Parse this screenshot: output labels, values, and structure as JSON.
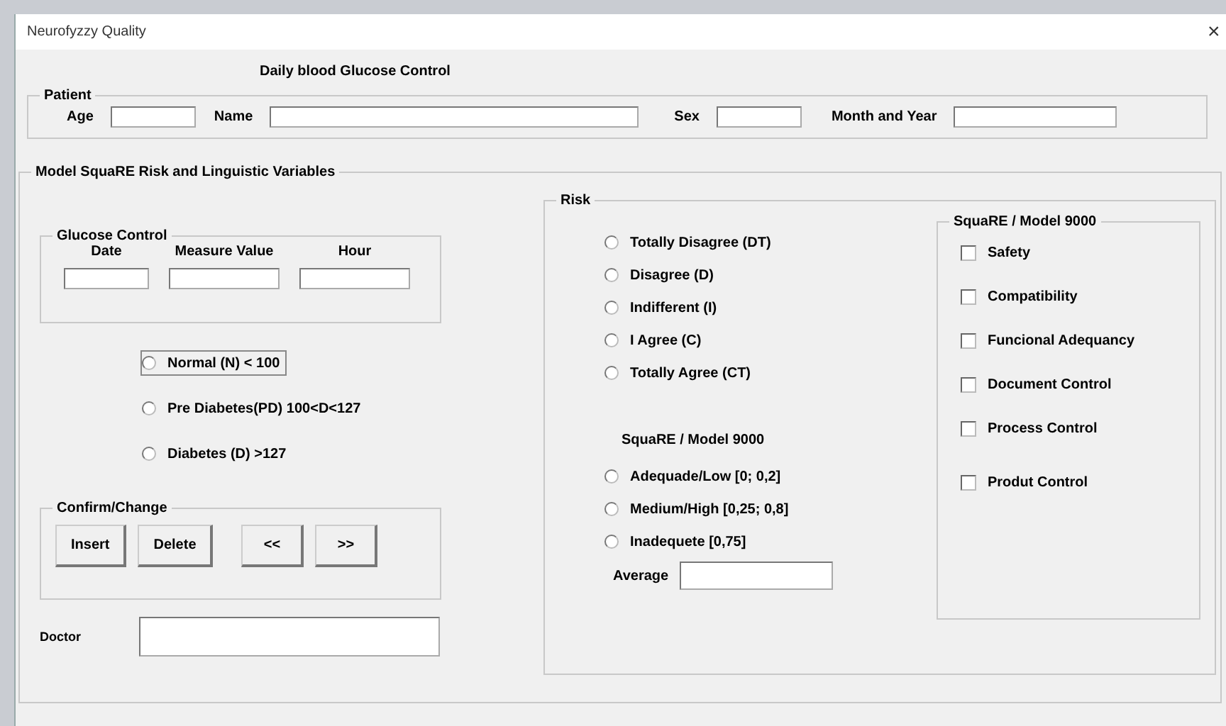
{
  "window": {
    "title": "Neurofyzzy Quality",
    "close": "×"
  },
  "heading": "Daily blood Glucose Control",
  "patient": {
    "legend": "Patient",
    "fields": [
      {
        "label": "Age"
      },
      {
        "label": "Name"
      },
      {
        "label": "Sex"
      },
      {
        "label": "Month and Year"
      }
    ]
  },
  "model": {
    "legend": "Model SquaRE Risk and Linguistic Variables",
    "glucose_control": {
      "legend": "Glucose Control",
      "columns": [
        "Date",
        "Measure Value",
        "Hour"
      ]
    },
    "glucose_levels": [
      {
        "label": "Normal (N) < 100",
        "selected": false,
        "focused": true
      },
      {
        "label": "Pre Diabetes(PD) 100<D<127",
        "selected": false,
        "focused": false
      },
      {
        "label": "Diabetes (D) >127",
        "selected": false,
        "focused": false
      }
    ],
    "confirm": {
      "legend": "Confirm/Change",
      "buttons": [
        "Insert",
        "Delete",
        "<<",
        ">>"
      ]
    },
    "doctor": {
      "label": "Doctor"
    },
    "risk": {
      "legend": "Risk",
      "agreement": [
        {
          "label": "Totally Disagree (DT)",
          "selected": false
        },
        {
          "label": "Disagree (D)",
          "selected": false
        },
        {
          "label": "Indifferent (I)",
          "selected": false
        },
        {
          "label": "I Agree (C)",
          "selected": false
        },
        {
          "label": "Totally Agree (CT)",
          "selected": false
        }
      ],
      "levels_title": "SquaRE / Model 9000",
      "levels": [
        {
          "label": "Adequade/Low [0; 0,2]",
          "selected": false
        },
        {
          "label": "Medium/High [0,25; 0,8]",
          "selected": false
        },
        {
          "label": "Inadequete [0,75]",
          "selected": false
        }
      ],
      "average": {
        "label": "Average"
      },
      "model_9000": {
        "legend": "SquaRE / Model 9000",
        "items": [
          {
            "label": "Safety",
            "checked": false
          },
          {
            "label": "Compatibility",
            "checked": false
          },
          {
            "label": "Funcional Adequancy",
            "checked": false
          },
          {
            "label": "Document Control",
            "checked": false
          },
          {
            "label": "Process Control",
            "checked": false
          },
          {
            "label": "Produt Control",
            "checked": false
          }
        ]
      }
    }
  }
}
